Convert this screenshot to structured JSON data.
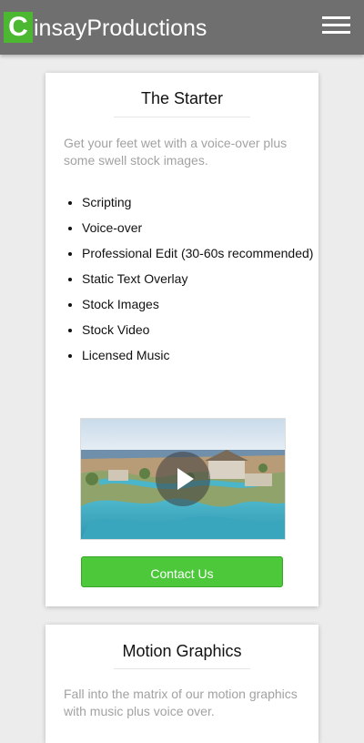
{
  "header": {
    "logo_letter": "C",
    "brand_rest": "insayProductions",
    "menu_icon": "hamburger-icon"
  },
  "cards": [
    {
      "title": "The Starter",
      "description": "Get your feet wet with a voice-over plus some swell stock images.",
      "features": [
        "Scripting",
        "Voice-over",
        "Professional Edit (30-60s recommended)",
        "Static Text Overlay",
        "Stock Images",
        "Stock Video",
        "Licensed Music"
      ],
      "media_icon": "play-icon",
      "button_label": "Contact Us"
    },
    {
      "title": "Motion Graphics",
      "description": "Fall into the matrix of our motion graphics with music plus voice over."
    }
  ],
  "colors": {
    "header_bg": "#6f6f6f",
    "brand_green": "#4cb832",
    "button_green": "#4cc83a",
    "page_bg": "#ececec"
  }
}
